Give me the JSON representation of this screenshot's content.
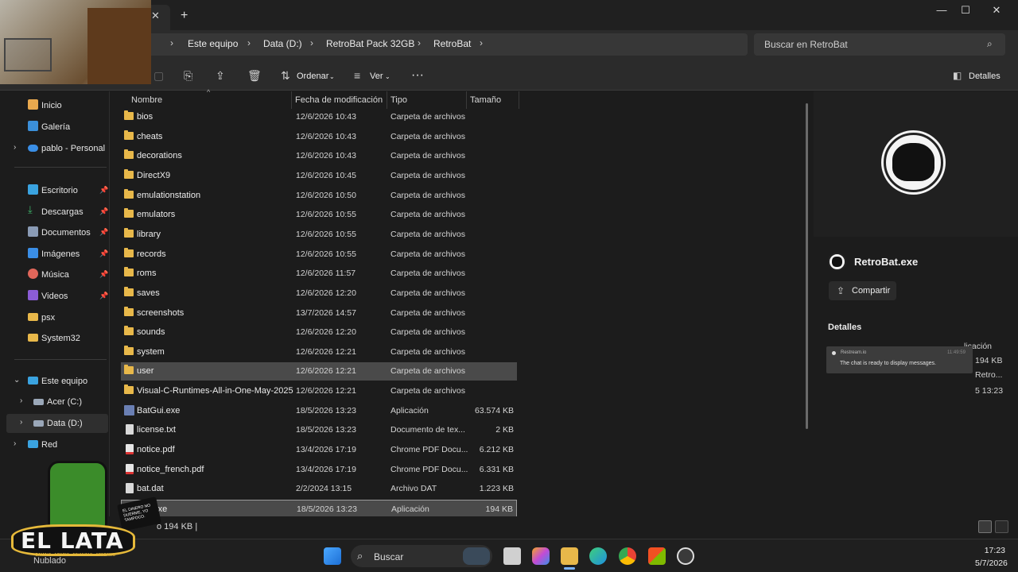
{
  "window": {
    "breadcrumbs": [
      "Este equipo",
      "Data (D:)",
      "RetroBat Pack 32GB",
      "RetroBat"
    ],
    "search_placeholder": "Buscar en RetroBat"
  },
  "toolbar": {
    "sort_label": "Ordenar",
    "view_label": "Ver",
    "more_label": "···",
    "details_label": "Detalles"
  },
  "sidebar": {
    "items": [
      {
        "label": "Inicio",
        "icon": "home-icon"
      },
      {
        "label": "Galería",
        "icon": "gallery-icon"
      },
      {
        "label": "pablo - Personal",
        "icon": "cloud-icon"
      },
      {
        "label": "Escritorio",
        "icon": "desktop-icon"
      },
      {
        "label": "Descargas",
        "icon": "download-icon"
      },
      {
        "label": "Documentos",
        "icon": "documents-icon"
      },
      {
        "label": "Imágenes",
        "icon": "pictures-icon"
      },
      {
        "label": "Música",
        "icon": "music-icon"
      },
      {
        "label": "Videos",
        "icon": "videos-icon"
      },
      {
        "label": "psx",
        "icon": "folder-icon"
      },
      {
        "label": "System32",
        "icon": "folder-icon"
      },
      {
        "label": "Este equipo",
        "icon": "computer-icon"
      },
      {
        "label": "Acer (C:)",
        "icon": "drive-icon"
      },
      {
        "label": "Data (D:)",
        "icon": "drive-icon"
      },
      {
        "label": "Red",
        "icon": "network-icon"
      }
    ]
  },
  "columns": {
    "name": "Nombre",
    "date": "Fecha de modificación",
    "type": "Tipo",
    "size": "Tamaño"
  },
  "files": [
    {
      "name": "bios",
      "date": "12/6/2026 10:43",
      "type": "Carpeta de archivos",
      "size": "",
      "kind": "folder"
    },
    {
      "name": "cheats",
      "date": "12/6/2026 10:43",
      "type": "Carpeta de archivos",
      "size": "",
      "kind": "folder"
    },
    {
      "name": "decorations",
      "date": "12/6/2026 10:43",
      "type": "Carpeta de archivos",
      "size": "",
      "kind": "folder"
    },
    {
      "name": "DirectX9",
      "date": "12/6/2026 10:45",
      "type": "Carpeta de archivos",
      "size": "",
      "kind": "folder"
    },
    {
      "name": "emulationstation",
      "date": "12/6/2026 10:50",
      "type": "Carpeta de archivos",
      "size": "",
      "kind": "folder"
    },
    {
      "name": "emulators",
      "date": "12/6/2026 10:55",
      "type": "Carpeta de archivos",
      "size": "",
      "kind": "folder"
    },
    {
      "name": "library",
      "date": "12/6/2026 10:55",
      "type": "Carpeta de archivos",
      "size": "",
      "kind": "folder"
    },
    {
      "name": "records",
      "date": "12/6/2026 10:55",
      "type": "Carpeta de archivos",
      "size": "",
      "kind": "folder"
    },
    {
      "name": "roms",
      "date": "12/6/2026 11:57",
      "type": "Carpeta de archivos",
      "size": "",
      "kind": "folder"
    },
    {
      "name": "saves",
      "date": "12/6/2026 12:20",
      "type": "Carpeta de archivos",
      "size": "",
      "kind": "folder"
    },
    {
      "name": "screenshots",
      "date": "13/7/2026 14:57",
      "type": "Carpeta de archivos",
      "size": "",
      "kind": "folder"
    },
    {
      "name": "sounds",
      "date": "12/6/2026 12:20",
      "type": "Carpeta de archivos",
      "size": "",
      "kind": "folder"
    },
    {
      "name": "system",
      "date": "12/6/2026 12:21",
      "type": "Carpeta de archivos",
      "size": "",
      "kind": "folder"
    },
    {
      "name": "user",
      "date": "12/6/2026 12:21",
      "type": "Carpeta de archivos",
      "size": "",
      "kind": "folder"
    },
    {
      "name": "Visual-C-Runtimes-All-in-One-May-2025",
      "date": "12/6/2026 12:21",
      "type": "Carpeta de archivos",
      "size": "",
      "kind": "folder"
    },
    {
      "name": "BatGui.exe",
      "date": "18/5/2026 13:23",
      "type": "Aplicación",
      "size": "63.574 KB",
      "kind": "exe"
    },
    {
      "name": "license.txt",
      "date": "18/5/2026 13:23",
      "type": "Documento de tex...",
      "size": "2 KB",
      "kind": "file"
    },
    {
      "name": "notice.pdf",
      "date": "13/4/2026 17:19",
      "type": "Chrome PDF Docu...",
      "size": "6.212 KB",
      "kind": "pdf"
    },
    {
      "name": "notice_french.pdf",
      "date": "13/4/2026 17:19",
      "type": "Chrome PDF Docu...",
      "size": "6.331 KB",
      "kind": "pdf"
    },
    {
      "name": "bat.dat",
      "date": "2/2/2024 13:15",
      "type": "Archivo DAT",
      "size": "1.223 KB",
      "kind": "file"
    },
    {
      "name": "Bat.exe",
      "date": "18/5/2026 13:23",
      "type": "Aplicación",
      "size": "194 KB",
      "kind": "exe"
    }
  ],
  "details": {
    "title": "RetroBat.exe",
    "share_label": "Compartir",
    "heading": "Detalles",
    "values": [
      "licación",
      "194 KB",
      "Retro...",
      "5 13:23"
    ]
  },
  "chat_toast": {
    "source": "Restream.io",
    "time": "11:49:59",
    "message": "The chat is ready to display messages."
  },
  "status": {
    "text": "o  194 KB  |"
  },
  "taskbar": {
    "search_label": "Buscar",
    "time": "17:23",
    "date": "5/7/2026",
    "weather": "Nublado"
  },
  "overlay": {
    "brand": "EL LATA",
    "tagline": "GAMING · MEMES · FINANZAS · STREAMS",
    "slogan": "EL DINERO NO DUERME, YO TAMPOCO."
  },
  "colors": {
    "folder": "#e8b84a",
    "selection": "#4a4a4a",
    "accent": "#7cb4ff"
  }
}
